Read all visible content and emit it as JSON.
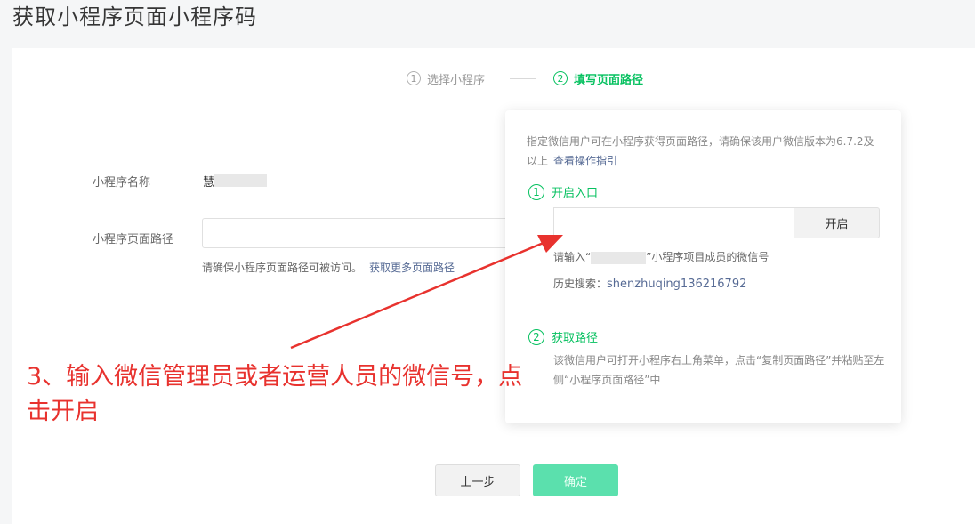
{
  "page": {
    "title": "获取小程序页面小程序码"
  },
  "stepper": {
    "step1": {
      "num": "1",
      "label": "选择小程序"
    },
    "step2": {
      "num": "2",
      "label": "填写页面路径"
    }
  },
  "form": {
    "name_label": "小程序名称",
    "name_value": "慧",
    "path_label": "小程序页面路径",
    "path_value": "",
    "path_hint": "请确保小程序页面路径可被访问。",
    "path_more_link": "获取更多页面路径"
  },
  "popover": {
    "desc": "指定微信用户可在小程序获得页面路径，请确保该用户微信版本为6.7.2及以上",
    "guide_link": "查看操作指引",
    "step1": {
      "num": "1",
      "title": "开启入口"
    },
    "wechat_input_value": "",
    "open_button": "开启",
    "input_hint_prefix": "请输入“",
    "input_hint_suffix": "”小程序项目成员的微信号",
    "history_label": "历史搜索：",
    "history_value": "shenzhuqing136216792",
    "step2": {
      "num": "2",
      "title": "获取路径"
    },
    "step2_desc": "该微信用户可打开小程序右上角菜单，点击“复制页面路径”并粘贴至左侧“小程序页面路径”中"
  },
  "buttons": {
    "prev": "上一步",
    "confirm": "确定"
  },
  "annotation": {
    "text": "3、输入微信管理员或者运营人员的微信号，点击开启"
  },
  "colors": {
    "accent": "#07c160",
    "link": "#576b95",
    "annotation": "#e8322e"
  }
}
